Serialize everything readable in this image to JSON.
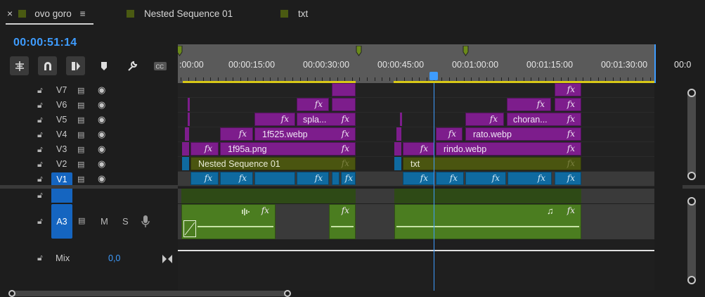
{
  "tabs": [
    {
      "label": "ovo goro",
      "has_close": true,
      "has_menu": true,
      "active": true
    },
    {
      "label": "Nested Sequence 01"
    },
    {
      "label": "txt"
    }
  ],
  "timecode": "00:00:51:14",
  "ruler": {
    "labels": [
      ":00:00",
      "00:00:15:00",
      "00:00:30:00",
      "00:00:45:00",
      "00:01:00:00",
      "00:01:15:00",
      "00:01:30:00",
      "00:0"
    ]
  },
  "video_tracks": [
    {
      "name": "V7"
    },
    {
      "name": "V6"
    },
    {
      "name": "V5"
    },
    {
      "name": "V4"
    },
    {
      "name": "V3"
    },
    {
      "name": "V2"
    },
    {
      "name": "V1",
      "targeted": true
    }
  ],
  "audio_track": {
    "name": "A3",
    "mute": "M",
    "solo": "S"
  },
  "mix": {
    "label": "Mix",
    "value": "0,0"
  },
  "clips": {
    "v5_a": "spla...",
    "v5_b": "choran...",
    "v4_a": "1f525.webp",
    "v4_b": "rato.webp",
    "v3_a": "1f95a.png",
    "v3_b": "rindo.webp",
    "v2_a": "Nested Sequence 01",
    "v2_b": "txt",
    "fx": "fx"
  },
  "colors": {
    "accent": "#3e9cff",
    "video_clip": "#7d1d8c",
    "nested_clip": "#4a5510",
    "v1_clip": "#0f6aa0",
    "audio_clip": "#4b7d20"
  }
}
